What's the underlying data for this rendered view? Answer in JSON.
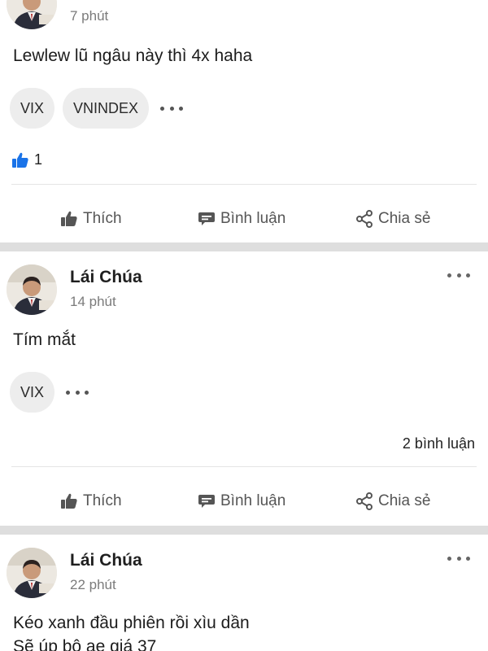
{
  "posts": [
    {
      "time": "7 phút",
      "content": "Lewlew lũ ngâu này thì 4x haha",
      "tags": [
        "VIX",
        "VNINDEX"
      ],
      "likes": "1",
      "actions": {
        "like": "Thích",
        "comment": "Bình luận",
        "share": "Chia sẻ"
      }
    },
    {
      "author": "Lái Chúa",
      "time": "14 phút",
      "content": "Tím mắt",
      "tags": [
        "VIX"
      ],
      "comments": "2 bình luận",
      "actions": {
        "like": "Thích",
        "comment": "Bình luận",
        "share": "Chia sẻ"
      }
    },
    {
      "author": "Lái Chúa",
      "time": "22 phút",
      "content_lines": [
        "Kéo xanh đầu phiên rồi xìu dần",
        "Sẽ úp bô ae giá 37"
      ]
    }
  ],
  "colors": {
    "like_blue": "#1a73e8",
    "separator": "#dedede",
    "tag_bg": "#ededed"
  },
  "icons": [
    "thumbs-up-icon",
    "comment-icon",
    "share-icon",
    "more-icon",
    "avatar"
  ]
}
